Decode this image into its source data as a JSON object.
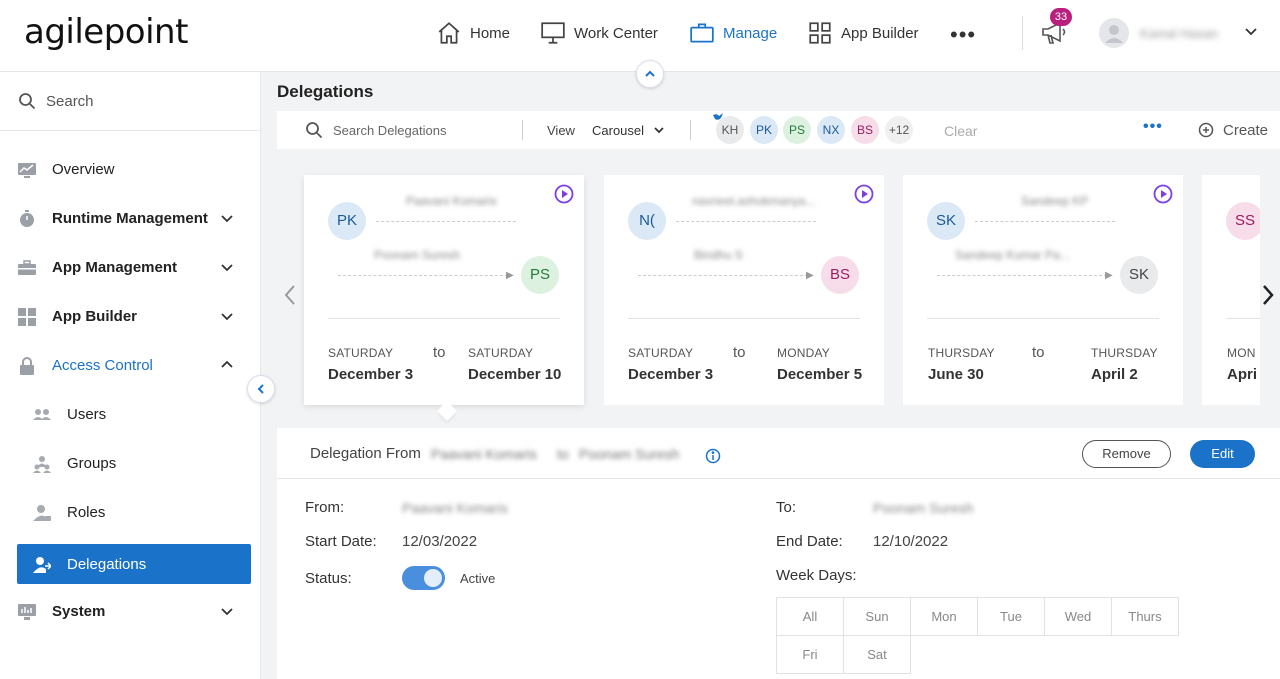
{
  "header": {
    "logo": "agilepoint",
    "nav": [
      {
        "label": "Home",
        "icon": "home-icon"
      },
      {
        "label": "Work Center",
        "icon": "monitor-icon"
      },
      {
        "label": "Manage",
        "icon": "briefcase-icon",
        "active": true
      },
      {
        "label": "App Builder",
        "icon": "grid-icon"
      }
    ],
    "more": "•••",
    "notifications_count": "33",
    "user_name": "Kamal Hasan"
  },
  "sidebar": {
    "search_placeholder": "Search",
    "items": [
      {
        "label": "Overview",
        "icon": "chart-icon"
      },
      {
        "label": "Runtime Management",
        "icon": "stopwatch-icon"
      },
      {
        "label": "App Management",
        "icon": "toolbox-icon"
      },
      {
        "label": "App Builder",
        "icon": "app-builder-icon"
      },
      {
        "label": "Access Control",
        "icon": "lock-icon"
      },
      {
        "label": "Users",
        "icon": "users-icon"
      },
      {
        "label": "Groups",
        "icon": "groups-icon"
      },
      {
        "label": "Roles",
        "icon": "roles-icon"
      },
      {
        "label": "Delegations",
        "icon": "delegations-icon"
      },
      {
        "label": "System",
        "icon": "system-icon"
      }
    ]
  },
  "page": {
    "title": "Delegations"
  },
  "toolbar": {
    "search_placeholder": "Search Delegations",
    "view_label": "View",
    "view_value": "Carousel",
    "chips": [
      "KH",
      "PK",
      "PS",
      "NX",
      "BS",
      "+12"
    ],
    "clear_label": "Clear",
    "more": "•••",
    "create_label": "Create"
  },
  "cards": [
    {
      "from_initials": "PK",
      "from_name": "Paavani Komaris",
      "to_name": "Poonam Suresh",
      "to_initials": "PS",
      "start_day": "SATURDAY",
      "start_date": "December 3",
      "to_word": "to",
      "end_day": "SATURDAY",
      "end_date": "December 10"
    },
    {
      "from_initials": "N(",
      "from_name": "navneel.ashokmanya...",
      "to_name": "Bindhu S",
      "to_initials": "BS",
      "start_day": "SATURDAY",
      "start_date": "December 3",
      "to_word": "to",
      "end_day": "MONDAY",
      "end_date": "December 5"
    },
    {
      "from_initials": "SK",
      "from_name": "Sandeep KP",
      "to_name": "Sandeep Kumar Pa...",
      "to_initials": "SK",
      "start_day": "THURSDAY",
      "start_date": "June 30",
      "to_word": "to",
      "end_day": "THURSDAY",
      "end_date": "April 2"
    },
    {
      "from_initials": "SS",
      "start_day": "MON",
      "start_date": "Apri"
    }
  ],
  "detail": {
    "title": "Delegation From",
    "from_name": "Paavani Komaris",
    "connector": "to",
    "to_name": "Poonam Suresh",
    "remove_label": "Remove",
    "edit_label": "Edit",
    "from_label": "From:",
    "from_value": "Paavani Komaris",
    "to_label": "To:",
    "to_value": "Poonam Suresh",
    "start_label": "Start Date:",
    "start_value": "12/03/2022",
    "end_label": "End Date:",
    "end_value": "12/10/2022",
    "status_label": "Status:",
    "status_value": "Active",
    "weekdays_label": "Week Days:",
    "weekdays": [
      "All",
      "Sun",
      "Mon",
      "Tue",
      "Wed",
      "Thurs",
      "Fri",
      "Sat"
    ]
  },
  "colors": {
    "accent": "#1a73c9",
    "badge": "#b9207e",
    "play": "#7b3fe4"
  }
}
